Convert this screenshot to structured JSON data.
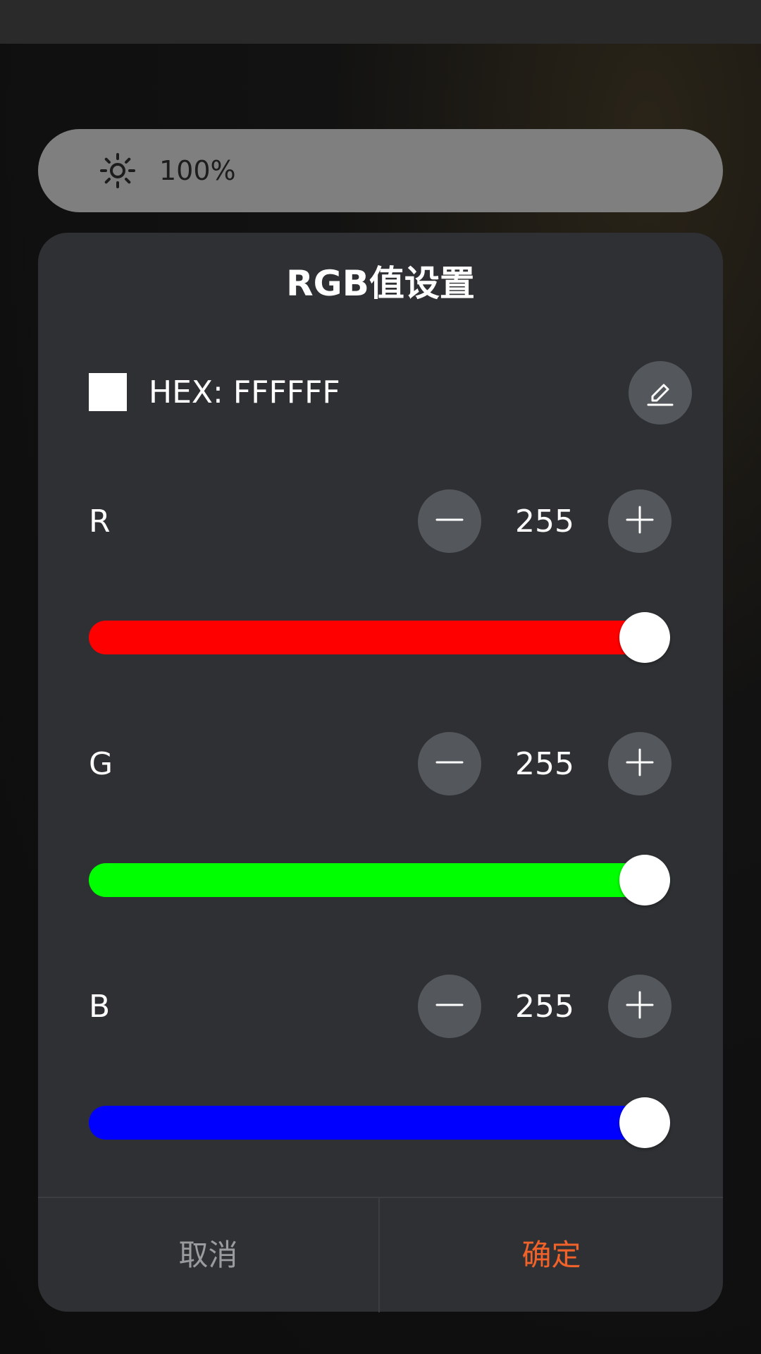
{
  "brightness": {
    "value_text": "100%",
    "icon": "sun-icon"
  },
  "dialog": {
    "title": "RGB值设置",
    "hex": {
      "label": "HEX: FFFFFF",
      "swatch_color": "#FFFFFF",
      "edit_icon": "pencil-icon"
    },
    "channels": [
      {
        "name": "R",
        "value": "255",
        "color": "#FF0000",
        "level": 1.0
      },
      {
        "name": "G",
        "value": "255",
        "color": "#00FF00",
        "level": 1.0
      },
      {
        "name": "B",
        "value": "255",
        "color": "#0000FF",
        "level": 1.0
      }
    ],
    "cancel_label": "取消",
    "confirm_label": "确定"
  },
  "colors": {
    "accent": "#F0622A",
    "dialog_bg": "#2E3033",
    "button_bg": "#54575B"
  }
}
